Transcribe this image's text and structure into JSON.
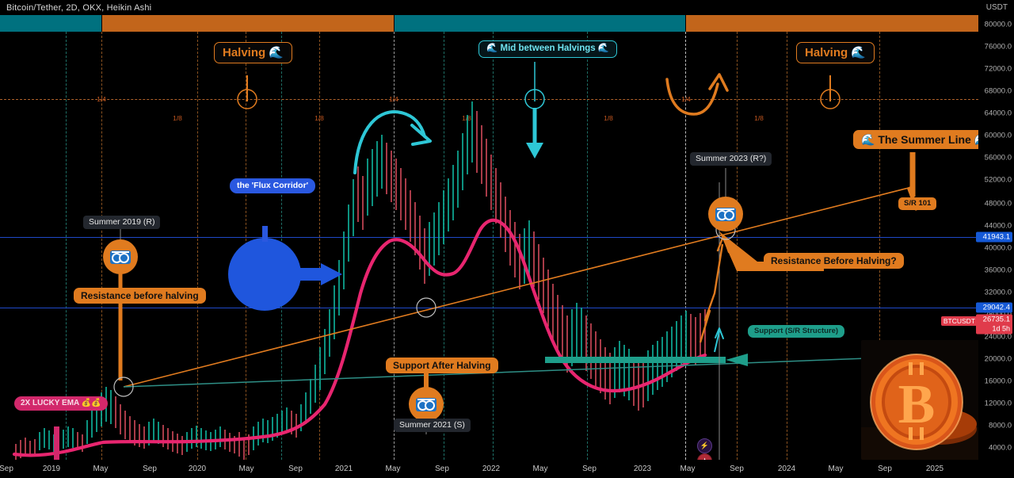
{
  "header": {
    "symbol_title": "Bitcoin/Tether, 2D, OKX, Heikin Ashi",
    "currency": "USDT"
  },
  "price_axis": {
    "ticks": [
      "80000.0",
      "76000.0",
      "72000.0",
      "68000.0",
      "64000.0",
      "60000.0",
      "56000.0",
      "52000.0",
      "48000.0",
      "44000.0",
      "40000.0",
      "36000.0",
      "32000.0",
      "28000.0",
      "24000.0",
      "20000.0",
      "16000.0",
      "12000.0",
      "8000.0",
      "4000.0"
    ],
    "tags": [
      {
        "text": "41943.1",
        "color": "#1559d6",
        "kind": "blue"
      },
      {
        "text": "29042.4",
        "color": "#1559d6",
        "kind": "blue"
      },
      {
        "text": "26735.1",
        "sub": "1d 5h",
        "color": "#e03b4b",
        "kind": "red"
      },
      {
        "text": "BTCUSDT",
        "color": "#e03b4b",
        "kind": "symbol"
      }
    ]
  },
  "time_axis": {
    "ticks": [
      "Sep",
      "2019",
      "May",
      "Sep",
      "2020",
      "May",
      "Sep",
      "2021",
      "May",
      "Sep",
      "2022",
      "May",
      "Sep",
      "2023",
      "May",
      "Sep",
      "2024",
      "May",
      "Sep",
      "2025"
    ]
  },
  "cycle_band": [
    {
      "label": "teal-phase-1",
      "color": "#00717f"
    },
    {
      "label": "orange-phase-1",
      "color": "#c2651b"
    },
    {
      "label": "teal-phase-2",
      "color": "#00717f"
    },
    {
      "label": "orange-phase-2",
      "color": "#c2651b"
    }
  ],
  "annotations": {
    "halving_left": "Halving 🌊",
    "halving_right": "Halving 🌊",
    "mid_between_halvings": "🌊 Mid between Halvings 🌊",
    "summer_line": "🌊 The Summer Line 🌊",
    "sr_101": "S/R 101",
    "summer_2019": "Summer 2019 (R)",
    "summer_2021": "Summer 2021 (S)",
    "summer_2023": "Summer 2023 (R?)",
    "resistance_before_halving": "Resistance before halving",
    "resistance_before_halving_q": "Resistance Before Halving?",
    "support_after_halving": "Support After Halving",
    "support_sr_structure": "Support (S/R Structure)",
    "flux_corridor": "the 'Flux Corridor'",
    "lucky_ema": "2X LUCKY EMA 💰💰"
  },
  "fractions": {
    "quarter": "1/4",
    "eighth": "1/8"
  },
  "colors": {
    "orange": "#e07b1f",
    "teal": "#1e9e8a",
    "cyan": "#2ec7d6",
    "blue": "#2a58e0",
    "pink": "#e8256f",
    "band_teal": "#00717f",
    "band_orange": "#c2651b",
    "bullish": "#0fb8a0",
    "bearish": "#d24a5a"
  },
  "chart_data": {
    "type": "line",
    "title": "Bitcoin/Tether, 2D, OKX, Heikin Ashi",
    "xlabel": "",
    "ylabel": "USDT",
    "ylim": [
      2000,
      82000
    ],
    "xlim": [
      "2018-09",
      "2025-09"
    ],
    "grid": true,
    "legend": "none",
    "last_price": 26735.1,
    "horizontal_levels": [
      {
        "value": 41943.1,
        "color": "#1559d6",
        "label": "41943.1"
      },
      {
        "value": 29042.4,
        "color": "#1559d6",
        "label": "29042.4"
      },
      {
        "value": 66500,
        "color": "#b0622b",
        "label": "halving-mid dashed"
      }
    ],
    "series": [
      {
        "name": "2X LUCKY EMA",
        "color": "#e8256f",
        "x": [
          "2018-10",
          "2019-01",
          "2019-04",
          "2019-07",
          "2019-10",
          "2020-01",
          "2020-04",
          "2020-07",
          "2020-10",
          "2021-01",
          "2021-03",
          "2021-05",
          "2021-07",
          "2021-09",
          "2021-11",
          "2022-01",
          "2022-04",
          "2022-07",
          "2022-10",
          "2023-01",
          "2023-04",
          "2023-06"
        ],
        "values": [
          5200,
          4200,
          4300,
          5200,
          5400,
          5600,
          5800,
          7500,
          11000,
          22000,
          42000,
          47000,
          40000,
          44000,
          50500,
          49000,
          42000,
          33000,
          25000,
          21500,
          24500,
          27000
        ]
      },
      {
        "name": "Summer Line (rising trend)",
        "color": "#e07b1f",
        "x": [
          "2019-04",
          "2025-07"
        ],
        "values": [
          17000,
          55000
        ]
      },
      {
        "name": "Lower support trend",
        "color": "#1e9e8a",
        "x": [
          "2019-04",
          "2025-07"
        ],
        "values": [
          17000,
          21500
        ]
      }
    ],
    "price_candles_summary": {
      "note": "Heikin Ashi 2D candles",
      "ath_2021_april": 64800,
      "ath_2021_november": 69000,
      "low_2018_dec": 3200,
      "low_2022_nov": 15500,
      "current": 26735.1
    }
  }
}
